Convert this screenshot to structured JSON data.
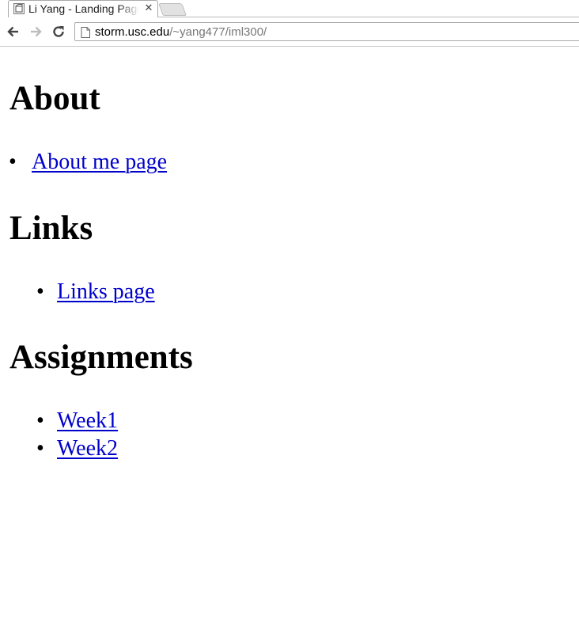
{
  "browser": {
    "tab": {
      "title": "Li Yang - Landing Page",
      "favicon": "page-favicon",
      "close_glyph": "✕"
    },
    "nav": {
      "back_icon": "back-arrow-icon",
      "forward_icon": "forward-arrow-icon",
      "reload_icon": "reload-icon"
    },
    "address": {
      "page_icon": "page-icon",
      "host": "storm.usc.edu",
      "path": "/~yang477/iml300/"
    }
  },
  "page": {
    "sections": [
      {
        "heading": "About",
        "links": [
          "About me page"
        ]
      },
      {
        "heading": "Links",
        "links": [
          "Links page"
        ]
      },
      {
        "heading": "Assignments",
        "links": [
          "Week1",
          "Week2"
        ]
      }
    ]
  },
  "colors": {
    "link": "#0000cc",
    "url_path": "#777777",
    "chrome_border": "#a9a9a9"
  }
}
